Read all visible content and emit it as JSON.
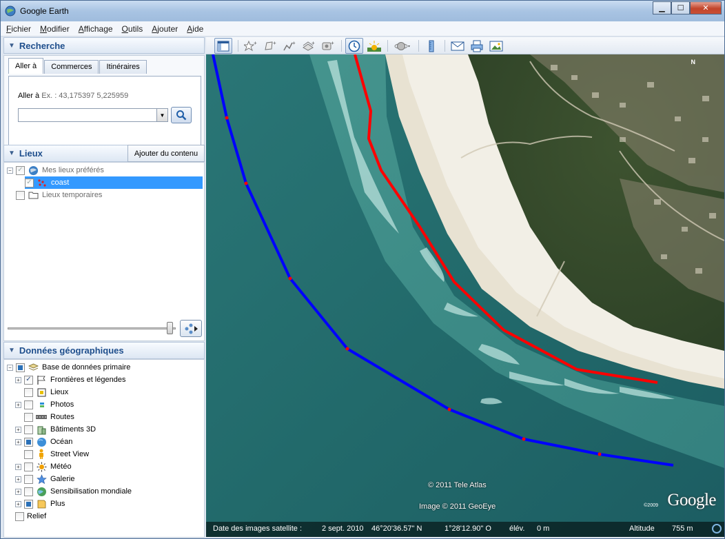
{
  "window": {
    "title": "Google Earth"
  },
  "menu": [
    "Fichier",
    "Modifier",
    "Affichage",
    "Outils",
    "Ajouter",
    "Aide"
  ],
  "search": {
    "title": "Recherche",
    "tabs": [
      "Aller à",
      "Commerces",
      "Itinéraires"
    ],
    "goto_label": "Aller à",
    "goto_example": "Ex. : 43,175397 5,225959",
    "input_value": ""
  },
  "places": {
    "title": "Lieux",
    "add_content": "Ajouter du contenu",
    "items": [
      {
        "label": "Mes lieux préférés",
        "checked": true
      },
      {
        "label": "coast",
        "checked": true,
        "selected": true
      },
      {
        "label": "Lieux temporaires",
        "checked": false
      }
    ]
  },
  "layers": {
    "title": "Données géographiques",
    "root": "Base de données primaire",
    "items": [
      {
        "label": "Frontières et légendes",
        "expandable": true,
        "state": "checked"
      },
      {
        "label": "Lieux",
        "expandable": false,
        "state": "unchecked"
      },
      {
        "label": "Photos",
        "expandable": true,
        "state": "unchecked"
      },
      {
        "label": "Routes",
        "expandable": false,
        "state": "unchecked"
      },
      {
        "label": "Bâtiments 3D",
        "expandable": true,
        "state": "unchecked"
      },
      {
        "label": "Océan",
        "expandable": true,
        "state": "partial"
      },
      {
        "label": "Street View",
        "expandable": false,
        "state": "unchecked"
      },
      {
        "label": "Météo",
        "expandable": true,
        "state": "unchecked"
      },
      {
        "label": "Galerie",
        "expandable": true,
        "state": "unchecked"
      },
      {
        "label": "Sensibilisation mondiale",
        "expandable": true,
        "state": "unchecked"
      },
      {
        "label": "Plus",
        "expandable": true,
        "state": "partial"
      }
    ],
    "relief": {
      "label": "Relief",
      "state": "unchecked"
    }
  },
  "map": {
    "attribution_teleatlas": "© 2011 Tele Atlas",
    "attribution_geoeye": "Image © 2011 GeoEye",
    "logo": "Google",
    "logo_year": "©2009",
    "north": "N",
    "colors": {
      "coast_line": "#ff0000",
      "offshore_line": "#0000ff",
      "vertex": "#ff0000"
    }
  },
  "status": {
    "date_label": "Date des images satellite :",
    "date_value": "2 sept. 2010",
    "lat": "46°20'36.57\" N",
    "lon": "1°28'12.90\" O",
    "elev_label": "élév.",
    "elev_value": "0 m",
    "altitude_label": "Altitude",
    "altitude_value": "755 m"
  }
}
